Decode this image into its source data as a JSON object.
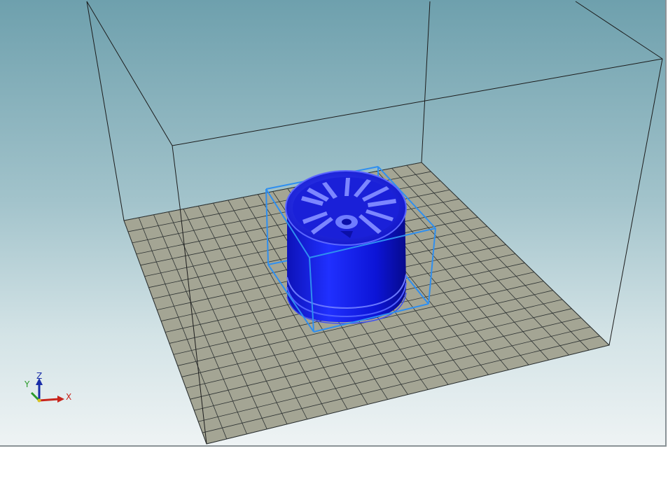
{
  "viewport": {
    "name": "3d-build-volume-view"
  },
  "axes_indicator": {
    "x_label": "X",
    "y_label": "Y",
    "z_label": "Z",
    "x_color": "#c8251c",
    "y_color": "#2a9a2a",
    "z_color": "#1a2ea8"
  },
  "colors": {
    "model": "#1a1aee",
    "bounding_box": "#2f8ff0",
    "build_plate": "#a4a594",
    "grid_line": "#2d3232",
    "volume_edge": "#1b1b1b"
  },
  "build_plate_grid": {
    "divisions": 20
  }
}
